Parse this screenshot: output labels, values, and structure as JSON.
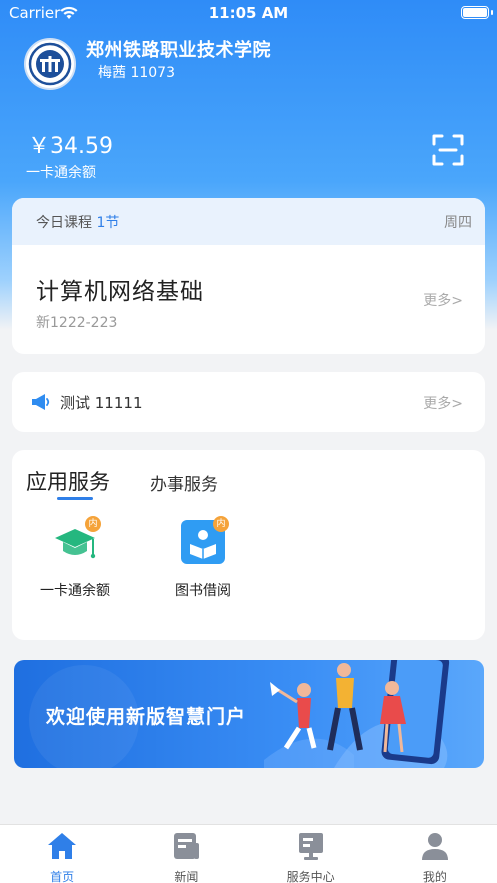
{
  "status_bar": {
    "carrier": "Carrier",
    "time": "11:05 AM"
  },
  "header": {
    "school_name": "郑州铁路职业技术学院",
    "user_line": "梅茜 11073",
    "balance": "￥34.59",
    "balance_label": "一卡通余额"
  },
  "course": {
    "today_label": "今日课程",
    "count": "1节",
    "weekday": "周四",
    "name": "计算机网络基础",
    "room": "新1222-223",
    "more": "更多>"
  },
  "notice": {
    "text": "测试 11111",
    "more": "更多>"
  },
  "services": {
    "tabs": [
      "应用服务",
      "办事服务"
    ],
    "items": [
      {
        "label": "一卡通余额",
        "badge": "内",
        "icon": "graduation-cap-icon"
      },
      {
        "label": "图书借阅",
        "badge": "内",
        "icon": "book-reader-icon"
      }
    ]
  },
  "banner": {
    "text": "欢迎使用新版智慧门户"
  },
  "tabbar": {
    "items": [
      {
        "label": "首页",
        "icon": "home-icon"
      },
      {
        "label": "新闻",
        "icon": "news-icon"
      },
      {
        "label": "服务中心",
        "icon": "service-center-icon"
      },
      {
        "label": "我的",
        "icon": "profile-icon"
      }
    ]
  },
  "colors": {
    "accent": "#2f7fe8",
    "badge": "#f5a33a",
    "cap": "#25b77f"
  }
}
